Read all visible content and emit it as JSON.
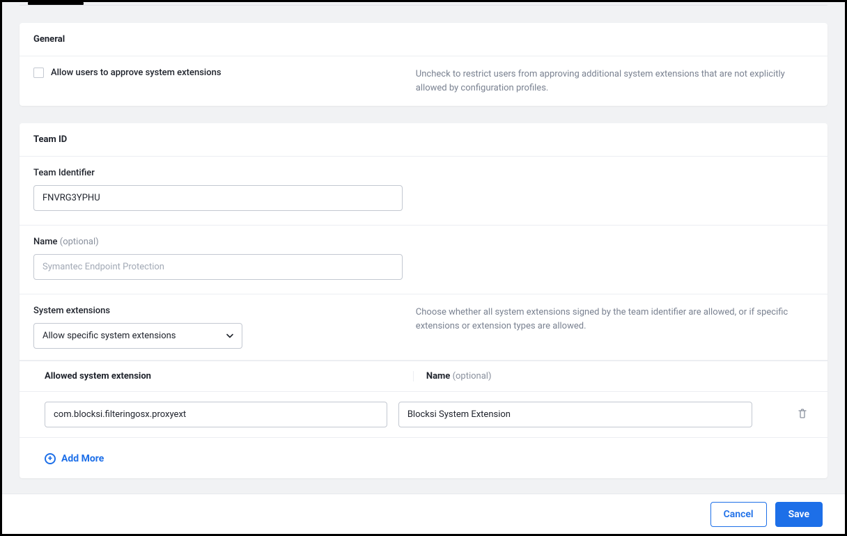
{
  "general": {
    "title": "General",
    "allow_users_label": "Allow users to approve system extensions",
    "allow_users_help": "Uncheck to restrict users from approving additional system extensions that are not explicitly allowed by configuration profiles."
  },
  "team_id": {
    "title": "Team ID",
    "team_identifier_label": "Team Identifier",
    "team_identifier_value": "FNVRG3YPHU",
    "name_label": "Name ",
    "name_optional": "(optional)",
    "name_placeholder": "Symantec Endpoint Protection",
    "system_extensions_label": "System extensions",
    "system_extensions_help": "Choose whether all system extensions signed by the team identifier are allowed, or if specific extensions or extension types are allowed.",
    "system_extensions_selected": "Allow specific system extensions",
    "table": {
      "header_left": "Allowed system extension",
      "header_right_label": "Name ",
      "header_right_optional": "(optional)",
      "rows": [
        {
          "extension": "com.blocksi.filteringosx.proxyext",
          "name": "Blocksi System Extension"
        }
      ]
    },
    "add_more_label": "Add More"
  },
  "footer": {
    "cancel_label": "Cancel",
    "save_label": "Save"
  }
}
